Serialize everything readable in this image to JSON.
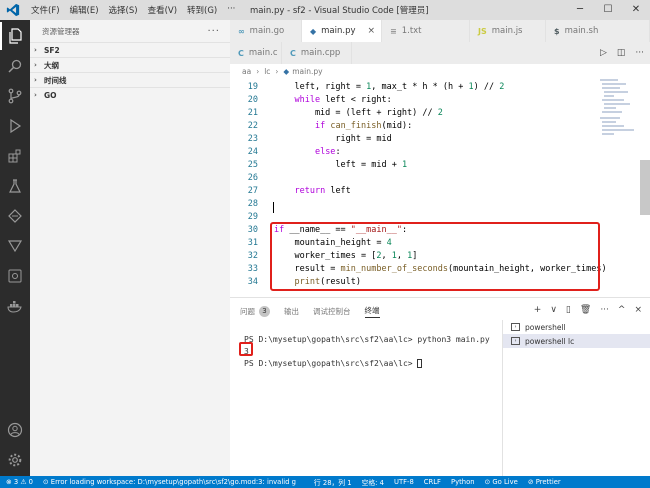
{
  "window": {
    "title": "main.py - sf2 - Visual Studio Code [管理员]",
    "menus": [
      "文件(F)",
      "编辑(E)",
      "选择(S)",
      "查看(V)",
      "转到(G)"
    ],
    "more": "···"
  },
  "sidebar": {
    "header": "资源管理器",
    "more": "···",
    "sections": [
      "SF2",
      "大纲",
      "时间线",
      "GO"
    ]
  },
  "tabs_row1": [
    {
      "label": "main.go",
      "icon": "go-file-icon",
      "active": false
    },
    {
      "label": "main.py",
      "icon": "python-file-icon",
      "active": true,
      "close": "×"
    },
    {
      "label": "1.txt",
      "icon": "text-file-icon",
      "active": false
    },
    {
      "label": "main.js",
      "icon": "js-file-icon",
      "active": false
    },
    {
      "label": "main.sh",
      "icon": "shell-file-icon",
      "active": false
    }
  ],
  "tabs_row2": [
    {
      "label": "main.c",
      "icon": "c-file-icon"
    },
    {
      "label": "main.cpp",
      "icon": "cpp-file-icon"
    }
  ],
  "breadcrumb": [
    "aa",
    "lc",
    "main.py"
  ],
  "code": {
    "lines": [
      {
        "n": "19",
        "t": "    left, right = 1, max_t * h * (h + 1) // 2"
      },
      {
        "n": "20",
        "t": "    while left < right:"
      },
      {
        "n": "21",
        "t": "        mid = (left + right) // 2"
      },
      {
        "n": "22",
        "t": "        if can_finish(mid):"
      },
      {
        "n": "23",
        "t": "            right = mid"
      },
      {
        "n": "24",
        "t": "        else:"
      },
      {
        "n": "25",
        "t": "            left = mid + 1"
      },
      {
        "n": "26",
        "t": ""
      },
      {
        "n": "27",
        "t": "    return left"
      },
      {
        "n": "28",
        "t": ""
      },
      {
        "n": "29",
        "t": ""
      },
      {
        "n": "30",
        "t": "if __name__ == \"__main__\":"
      },
      {
        "n": "31",
        "t": "    mountain_height = 4"
      },
      {
        "n": "32",
        "t": "    worker_times = [2, 1, 1]"
      },
      {
        "n": "33",
        "t": "    result = min_number_of_seconds(mountain_height, worker_times)"
      },
      {
        "n": "34",
        "t": "    print(result)"
      }
    ]
  },
  "panel": {
    "tabs": [
      "问题",
      "输出",
      "调试控制台",
      "终端"
    ],
    "problems_count": "3",
    "actions": [
      "+",
      "∨",
      "▯",
      "🗑",
      "···",
      "^",
      "×"
    ]
  },
  "terminal": {
    "lines": [
      "PS D:\\mysetup\\gopath\\src\\sf2\\aa\\lc> python3 main.py",
      "3",
      "PS D:\\mysetup\\gopath\\src\\sf2\\aa\\lc> "
    ],
    "list": [
      {
        "label": "powershell",
        "active": false
      },
      {
        "label": "powershell  lc",
        "active": true
      }
    ]
  },
  "statusbar": {
    "problems": "⊗ 3 ⚠ 0",
    "error": "⊙ Error loading workspace: D:\\mysetup\\gopath\\src\\sf2\\go.mod:3: invalid g",
    "position": "行 28，列 1",
    "spaces": "空格: 4",
    "encoding": "UTF-8",
    "eol": "CRLF",
    "language": "Python",
    "golive": "⊙ Go Live",
    "prettier": "⊘ Prettier"
  },
  "colors": {
    "activitybar": "#2c2c2c",
    "statusbar": "#007acc",
    "highlight": "#e0201b"
  }
}
